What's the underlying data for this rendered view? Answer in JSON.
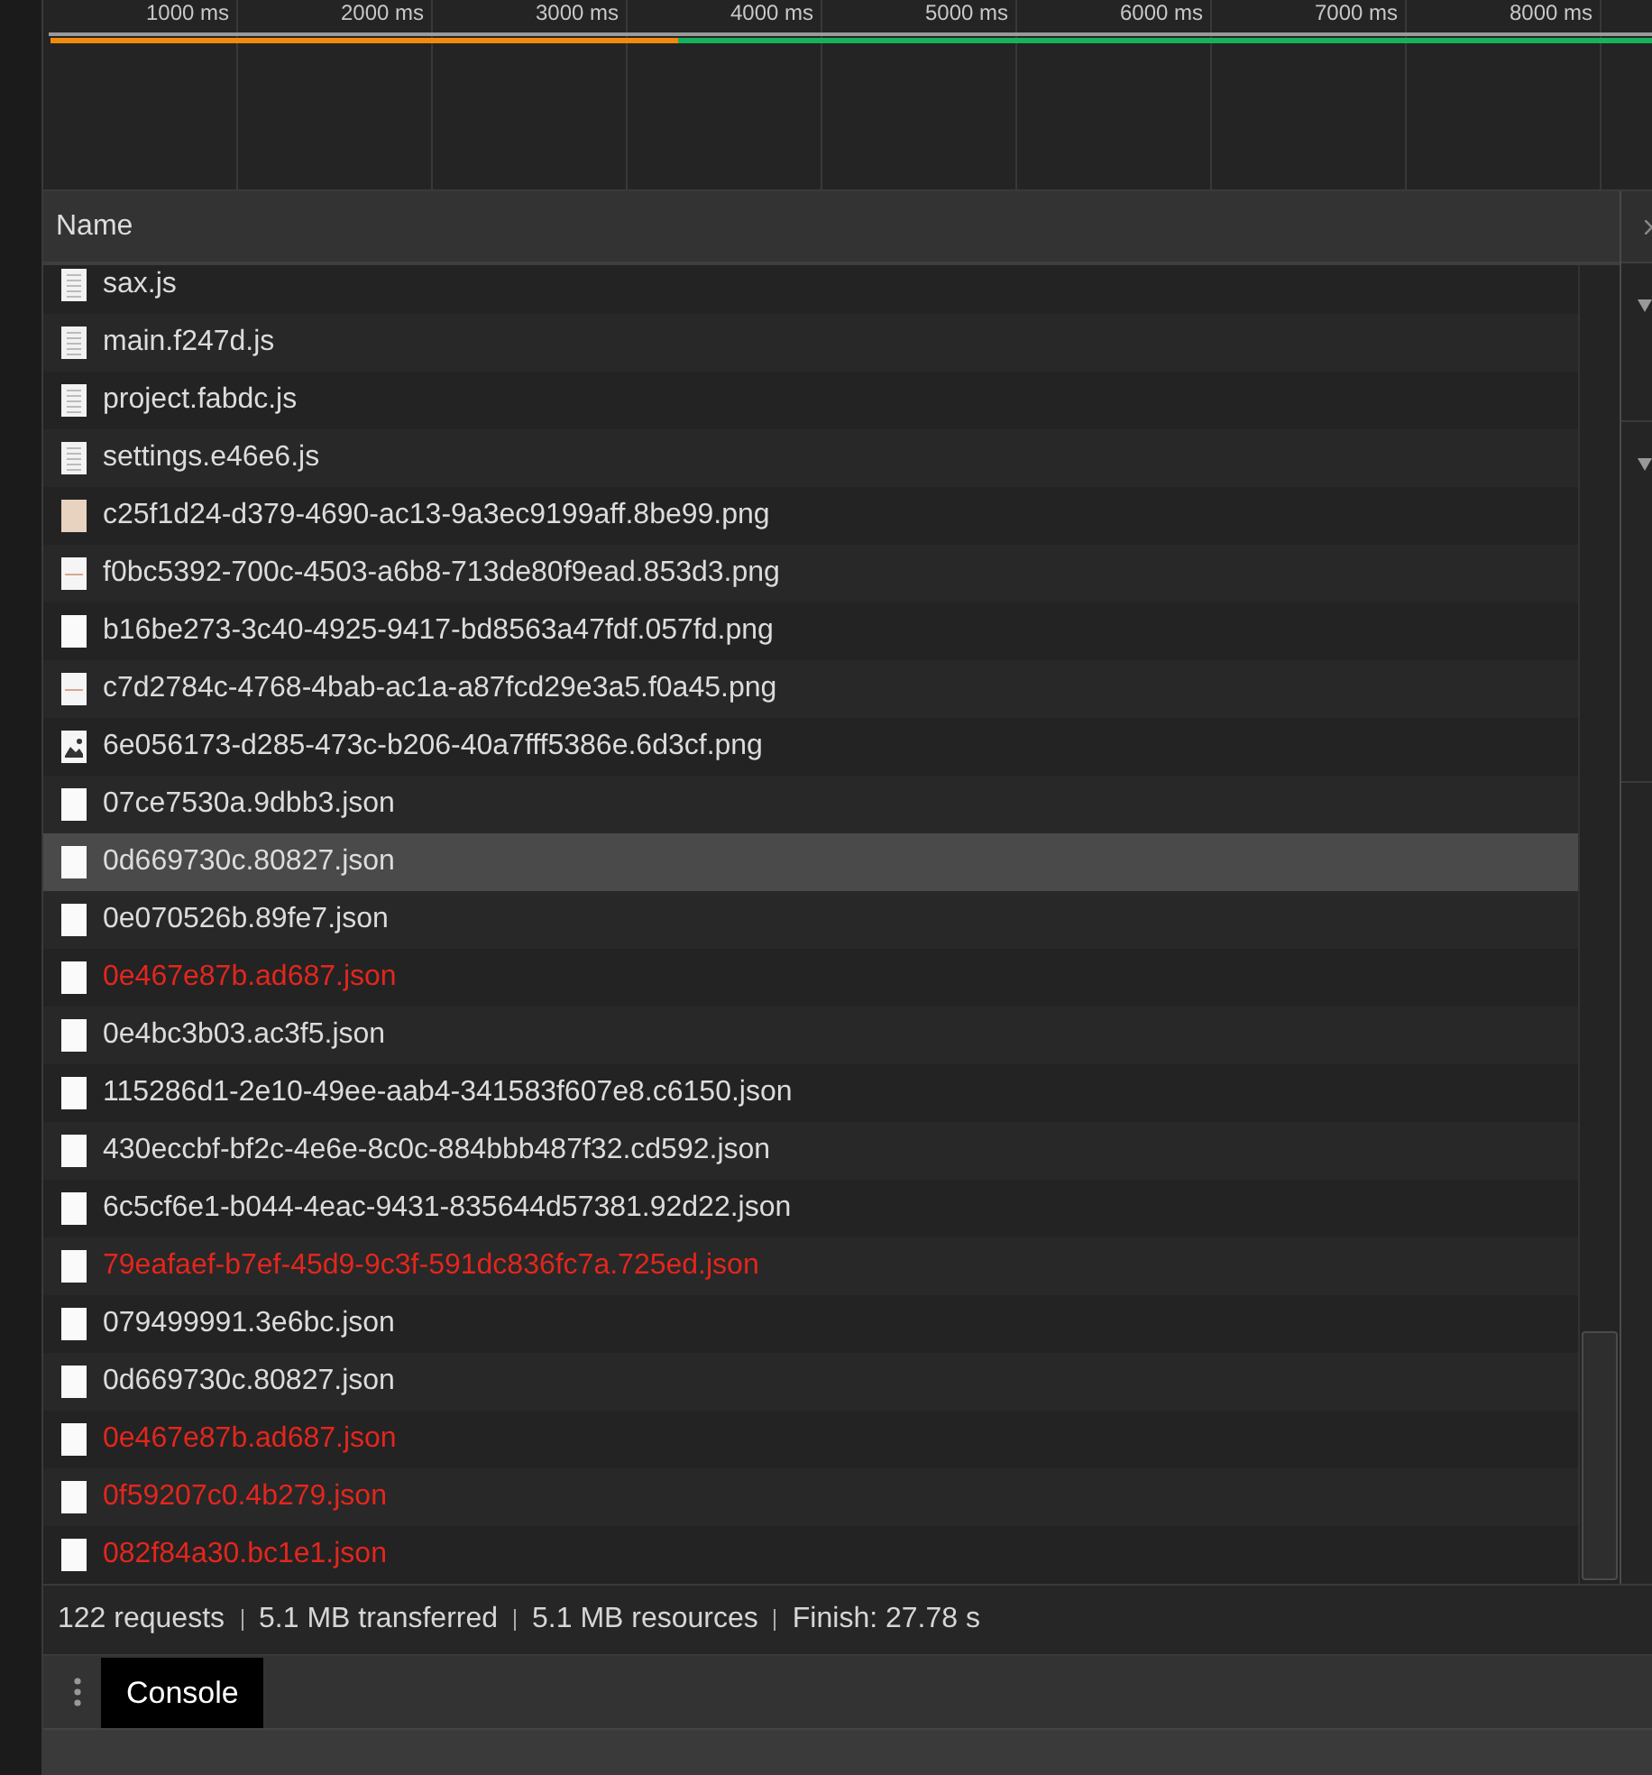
{
  "timeline": {
    "ticks": [
      "1000 ms",
      "2000 ms",
      "3000 ms",
      "4000 ms",
      "5000 ms",
      "6000 ms",
      "7000 ms",
      "8000 ms"
    ]
  },
  "table": {
    "columns": [
      "Name"
    ],
    "rows": [
      {
        "name": "sax.js",
        "kind": "script",
        "error": false,
        "selected": false
      },
      {
        "name": "main.f247d.js",
        "kind": "script",
        "error": false,
        "selected": false
      },
      {
        "name": "project.fabdc.js",
        "kind": "script",
        "error": false,
        "selected": false
      },
      {
        "name": "settings.e46e6.js",
        "kind": "script",
        "error": false,
        "selected": false
      },
      {
        "name": "c25f1d24-d379-4690-ac13-9a3ec9199aff.8be99.png",
        "kind": "swatch",
        "error": false,
        "selected": false
      },
      {
        "name": "f0bc5392-700c-4503-a6b8-713de80f9ead.853d3.png",
        "kind": "strip",
        "error": false,
        "selected": false
      },
      {
        "name": "b16be273-3c40-4925-9417-bd8563a47fdf.057fd.png",
        "kind": "blank",
        "error": false,
        "selected": false
      },
      {
        "name": "c7d2784c-4768-4bab-ac1a-a87fcd29e3a5.f0a45.png",
        "kind": "strip",
        "error": false,
        "selected": false
      },
      {
        "name": "6e056173-d285-473c-b206-40a7fff5386e.6d3cf.png",
        "kind": "photo",
        "error": false,
        "selected": false
      },
      {
        "name": "07ce7530a.9dbb3.json",
        "kind": "blank",
        "error": false,
        "selected": false
      },
      {
        "name": "0d669730c.80827.json",
        "kind": "blank",
        "error": false,
        "selected": true
      },
      {
        "name": "0e070526b.89fe7.json",
        "kind": "blank",
        "error": false,
        "selected": false
      },
      {
        "name": "0e467e87b.ad687.json",
        "kind": "blank",
        "error": true,
        "selected": false
      },
      {
        "name": "0e4bc3b03.ac3f5.json",
        "kind": "blank",
        "error": false,
        "selected": false
      },
      {
        "name": "115286d1-2e10-49ee-aab4-341583f607e8.c6150.json",
        "kind": "blank",
        "error": false,
        "selected": false
      },
      {
        "name": "430eccbf-bf2c-4e6e-8c0c-884bbb487f32.cd592.json",
        "kind": "blank",
        "error": false,
        "selected": false
      },
      {
        "name": "6c5cf6e1-b044-4eac-9431-835644d57381.92d22.json",
        "kind": "blank",
        "error": false,
        "selected": false
      },
      {
        "name": "79eafaef-b7ef-45d9-9c3f-591dc836fc7a.725ed.json",
        "kind": "blank",
        "error": true,
        "selected": false
      },
      {
        "name": "079499991.3e6bc.json",
        "kind": "blank",
        "error": false,
        "selected": false
      },
      {
        "name": "0d669730c.80827.json",
        "kind": "blank",
        "error": false,
        "selected": false
      },
      {
        "name": "0e467e87b.ad687.json",
        "kind": "blank",
        "error": true,
        "selected": false
      },
      {
        "name": "0f59207c0.4b279.json",
        "kind": "blank",
        "error": true,
        "selected": false
      },
      {
        "name": "082f84a30.bc1e1.json",
        "kind": "blank",
        "error": true,
        "selected": false
      }
    ]
  },
  "status_bar": [
    "122 requests",
    "5.1 MB transferred",
    "5.1 MB resources",
    "Finish: 27.78 s"
  ],
  "drawer": {
    "tabs": [
      {
        "label": "Console",
        "selected": true
      }
    ]
  }
}
